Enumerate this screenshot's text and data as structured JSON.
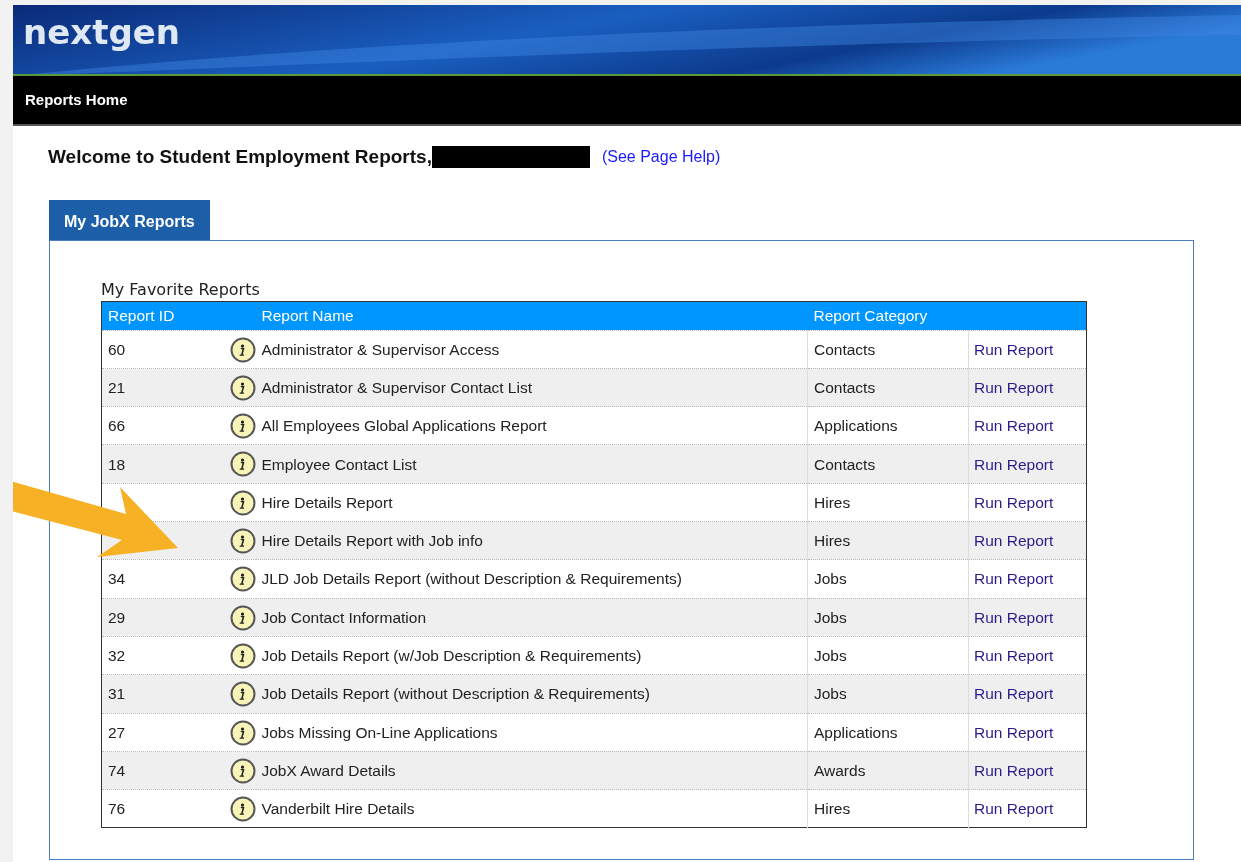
{
  "brand": {
    "logo": "nextgen"
  },
  "nav": {
    "items": [
      {
        "label": "Reports Home"
      }
    ]
  },
  "welcome": {
    "text": "Welcome to Student Employment Reports,",
    "redacted": true,
    "help_link": "(See Page Help)"
  },
  "tabs": [
    {
      "label": "My JobX Reports",
      "selected": true
    }
  ],
  "table": {
    "title": "My Favorite Reports",
    "columns": [
      "Report ID",
      "Report Name",
      "Report Category"
    ],
    "rows": [
      {
        "id": "60",
        "name": "Administrator & Supervisor Access",
        "category": "Contacts",
        "action": "Run Report"
      },
      {
        "id": "21",
        "name": "Administrator & Supervisor Contact List",
        "category": "Contacts",
        "action": "Run Report"
      },
      {
        "id": "66",
        "name": "All Employees Global Applications Report",
        "category": "Applications",
        "action": "Run Report"
      },
      {
        "id": "18",
        "name": "Employee Contact List",
        "category": "Contacts",
        "action": "Run Report"
      },
      {
        "name": "Hire Details Report",
        "category": "Hires",
        "action": "Run Report"
      },
      {
        "name": "Hire Details Report with Job info",
        "category": "Hires",
        "action": "Run Report"
      },
      {
        "id": "34",
        "name": "JLD Job Details Report (without Description & Requirements)",
        "category": "Jobs",
        "action": "Run Report"
      },
      {
        "id": "29",
        "name": "Job Contact Information",
        "category": "Jobs",
        "action": "Run Report"
      },
      {
        "id": "32",
        "name": "Job Details Report (w/Job Description & Requirements)",
        "category": "Jobs",
        "action": "Run Report"
      },
      {
        "id": "31",
        "name": "Job Details Report (without Description & Requirements)",
        "category": "Jobs",
        "action": "Run Report"
      },
      {
        "id": "27",
        "name": "Jobs Missing On-Line Applications",
        "category": "Applications",
        "action": "Run Report"
      },
      {
        "id": "74",
        "name": "JobX Award Details",
        "category": "Awards",
        "action": "Run Report"
      },
      {
        "id": "76",
        "name": "Vanderbilt Hire Details",
        "category": "Hires",
        "action": "Run Report"
      }
    ]
  },
  "annotation": {
    "kind": "arrow"
  }
}
